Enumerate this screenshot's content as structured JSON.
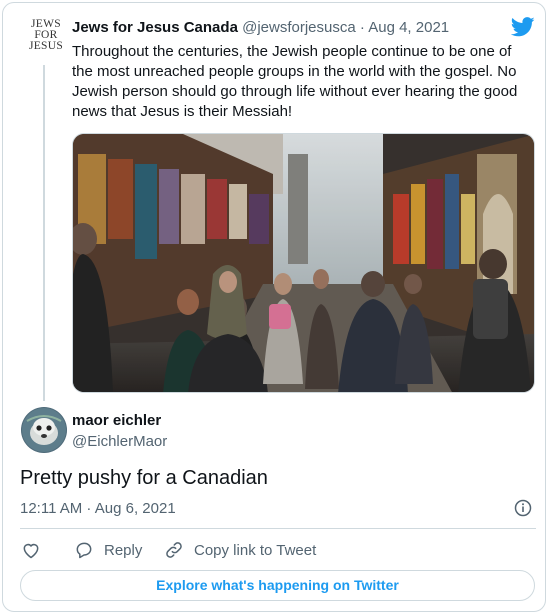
{
  "quoted_tweet": {
    "logo_lines": [
      "JEWS",
      "FOR",
      "JESUS"
    ],
    "author_name": "Jews for Jesus Canada",
    "author_handle": "@jewsforjesusca",
    "separator": " · ",
    "date": "Aug 4, 2021",
    "text": "Throughout the centuries, the Jewish people continue to be one of the most unreached people groups in the world with the gospel. No Jewish person should go through life without ever hearing the good news that Jesus is their Messiah!"
  },
  "reply": {
    "author_name": "maor eichler",
    "author_handle": "@EichlerMaor",
    "text": "Pretty pushy for a Canadian",
    "timestamp": "12:11 AM · Aug 6, 2021"
  },
  "actions": {
    "reply_label": "Reply",
    "copy_link_label": "Copy link to Tweet"
  },
  "explore_label": "Explore what's happening on Twitter",
  "colors": {
    "brand_blue": "#1d9bf0",
    "secondary_text": "#536471",
    "border": "#cfd9de"
  },
  "icons": [
    "twitter-bird-icon",
    "info-icon",
    "heart-icon",
    "reply-icon",
    "link-icon"
  ]
}
